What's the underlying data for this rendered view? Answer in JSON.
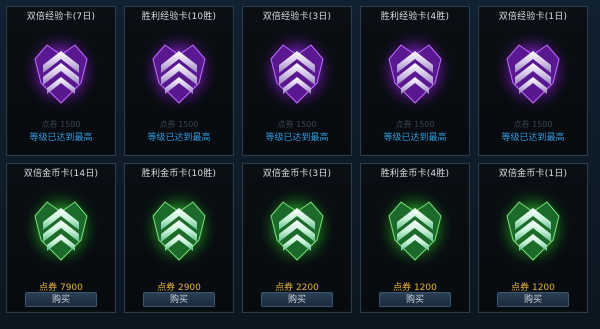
{
  "colors": {
    "exp_glow": "#a23cf0",
    "gold_glow": "#3cd040",
    "price": "#e6b43c",
    "max_level": "#2f9bde"
  },
  "exp_cards": [
    {
      "title": "双倍经验卡(7日)",
      "ghost_price": "点券 1500",
      "status": "等级已达到最高",
      "icon": "purple-chevron-rank-badge-icon"
    },
    {
      "title": "胜利经验卡(10胜)",
      "ghost_price": "点券 1500",
      "status": "等级已达到最高",
      "icon": "purple-chevron-rank-badge-icon"
    },
    {
      "title": "双倍经验卡(3日)",
      "ghost_price": "点券 1500",
      "status": "等级已达到最高",
      "icon": "purple-chevron-rank-badge-icon"
    },
    {
      "title": "胜利经验卡(4胜)",
      "ghost_price": "点券 1500",
      "status": "等级已达到最高",
      "icon": "purple-chevron-rank-badge-icon"
    },
    {
      "title": "双倍经验卡(1日)",
      "ghost_price": "点券 1500",
      "status": "等级已达到最高",
      "icon": "purple-chevron-rank-badge-icon"
    }
  ],
  "gold_cards": [
    {
      "title": "双倍金币卡(14日)",
      "price": "点券 7900",
      "button": "购买",
      "icon": "green-chevron-rank-badge-icon"
    },
    {
      "title": "胜利金币卡(10胜)",
      "price": "点券 2900",
      "button": "购买",
      "icon": "green-chevron-rank-badge-icon"
    },
    {
      "title": "双倍金币卡(3日)",
      "price": "点券 2200",
      "button": "购买",
      "icon": "green-chevron-rank-badge-icon"
    },
    {
      "title": "胜利金币卡(4胜)",
      "price": "点券 1200",
      "button": "购买",
      "icon": "green-chevron-rank-badge-icon"
    },
    {
      "title": "双倍金币卡(1日)",
      "price": "点券 1200",
      "button": "购买",
      "icon": "green-chevron-rank-badge-icon"
    }
  ]
}
